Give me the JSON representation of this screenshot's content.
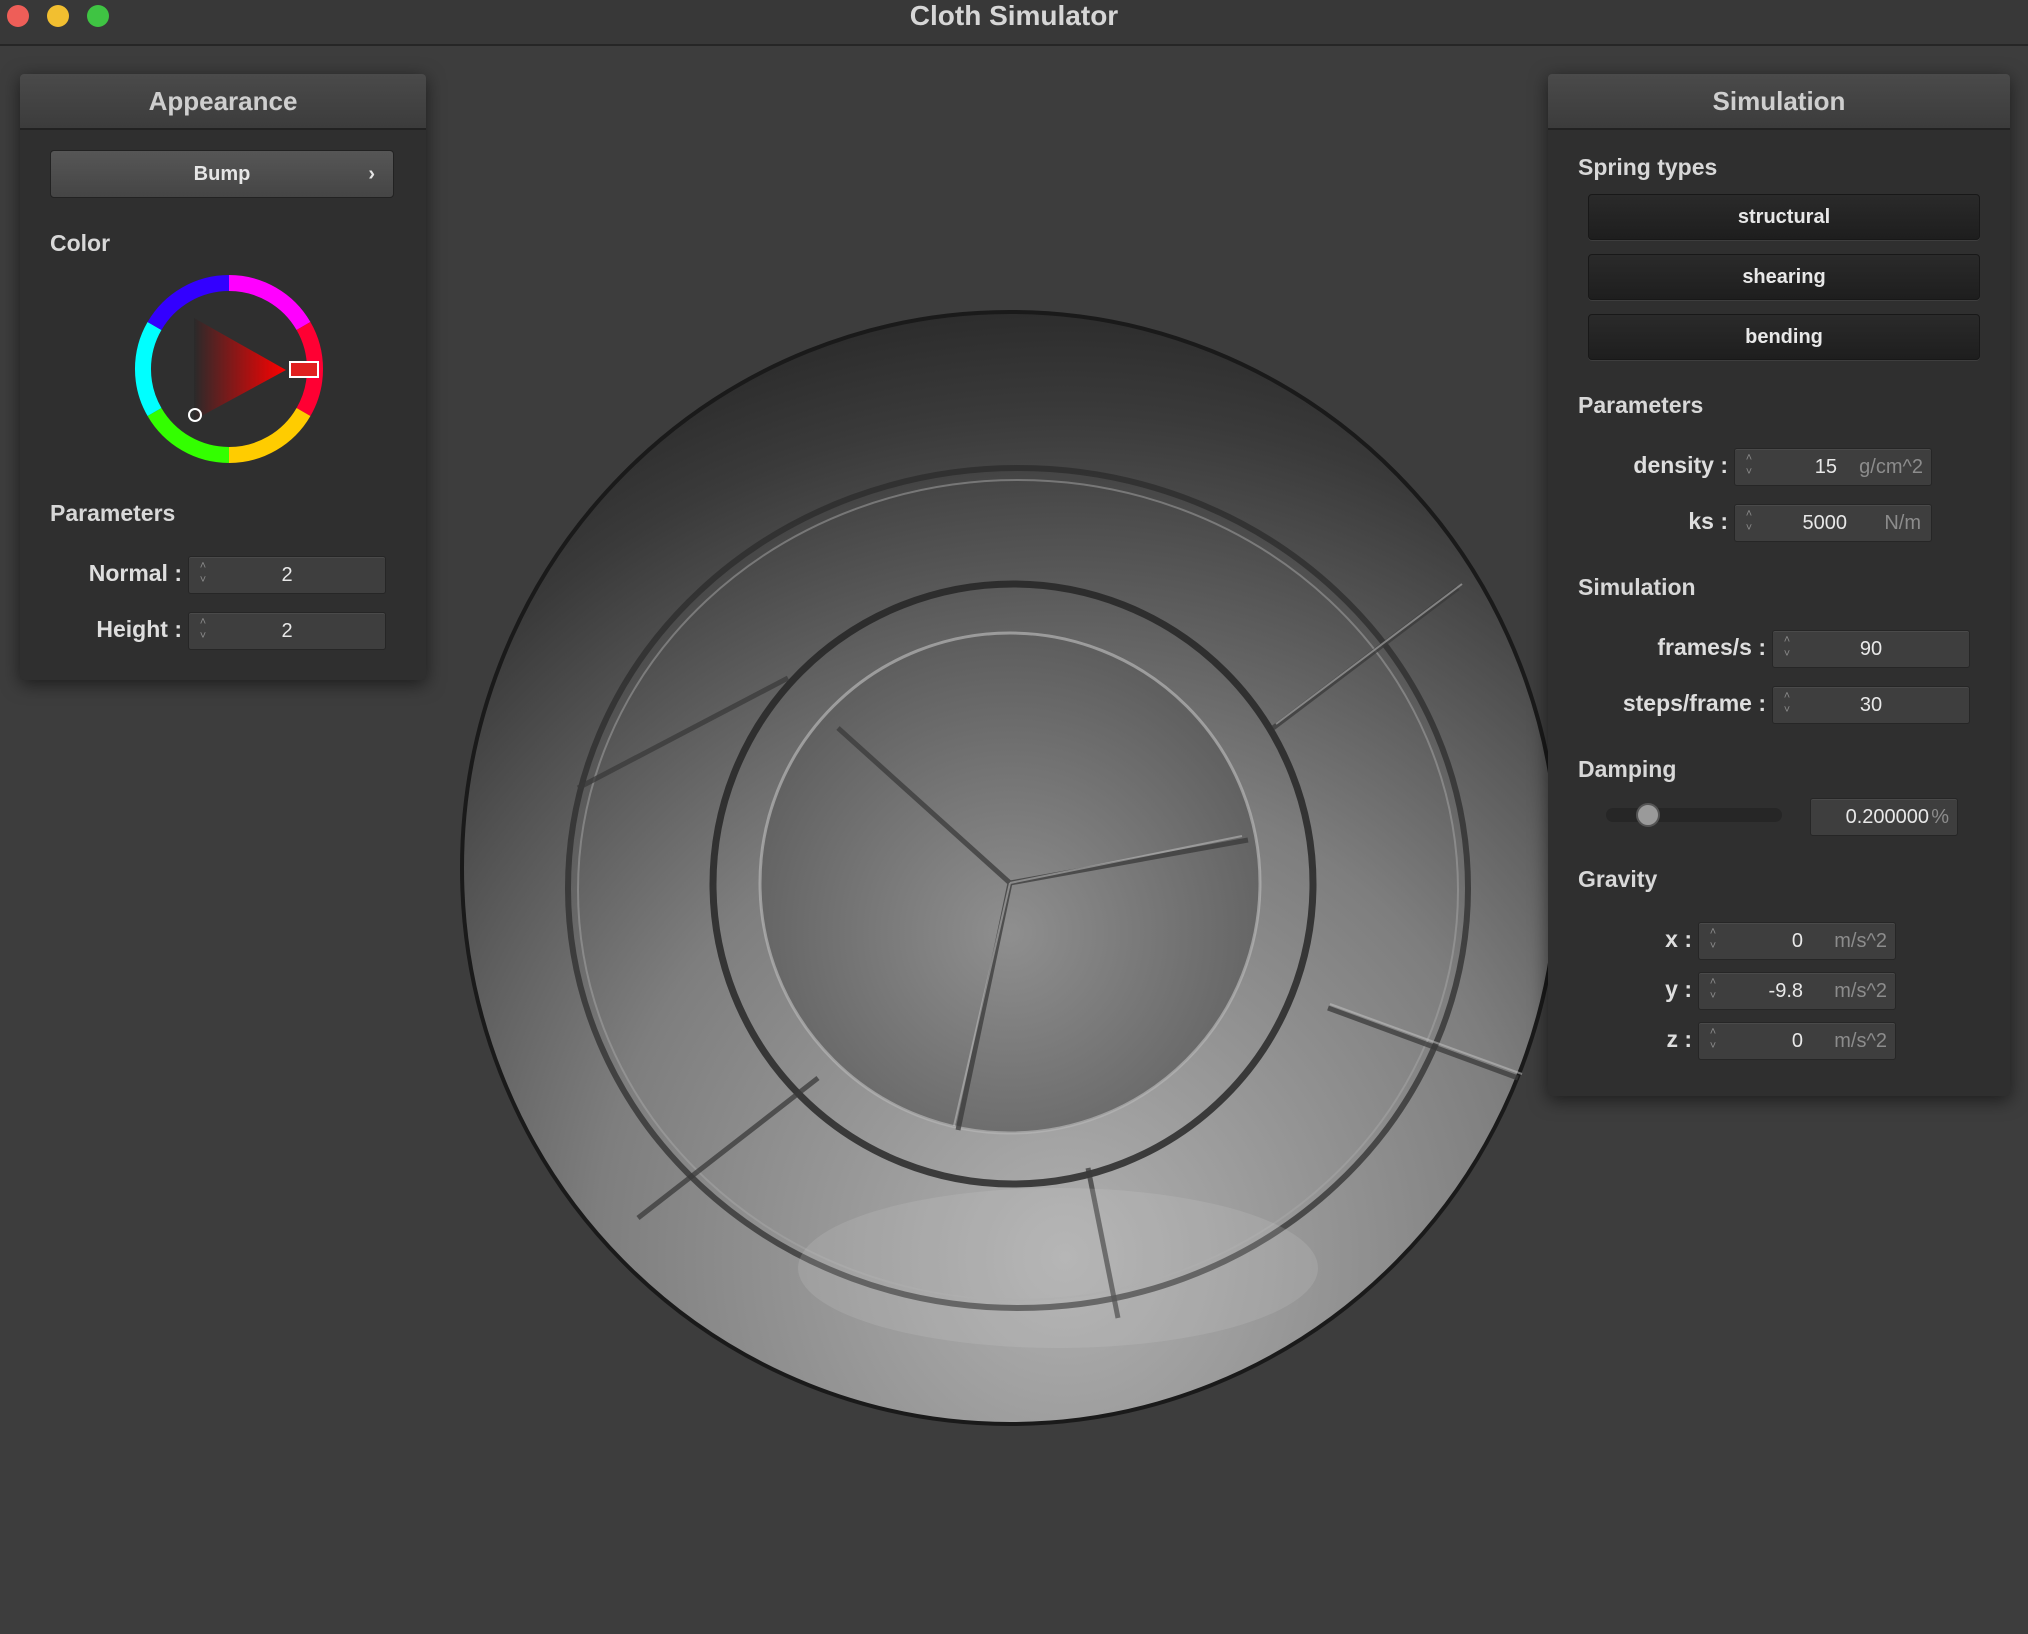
{
  "window": {
    "title": "Cloth Simulator"
  },
  "appearance": {
    "title": "Appearance",
    "shader": "Bump",
    "color_label": "Color",
    "color_hex": "#ff0000",
    "params_label": "Parameters",
    "normal_label": "Normal :",
    "normal_value": "2",
    "height_label": "Height :",
    "height_value": "2"
  },
  "simulation": {
    "title": "Simulation",
    "spring_types_label": "Spring types",
    "springs": [
      "structural",
      "shearing",
      "bending"
    ],
    "params_label": "Parameters",
    "density_label": "density :",
    "density_value": "15",
    "density_unit": "g/cm^2",
    "ks_label": "ks :",
    "ks_value": "5000",
    "ks_unit": "N/m",
    "sim_label": "Simulation",
    "fps_label": "frames/s :",
    "fps_value": "90",
    "steps_label": "steps/frame :",
    "steps_value": "30",
    "damping_label": "Damping",
    "damping_value": "0.200000",
    "damping_unit": "%",
    "damping_fraction": 0.2,
    "gravity_label": "Gravity",
    "gx_label": "x :",
    "gx_value": "0",
    "gy_label": "y :",
    "gy_value": "-9.8",
    "gz_label": "z :",
    "gz_value": "0",
    "gravity_unit": "m/s^2"
  }
}
